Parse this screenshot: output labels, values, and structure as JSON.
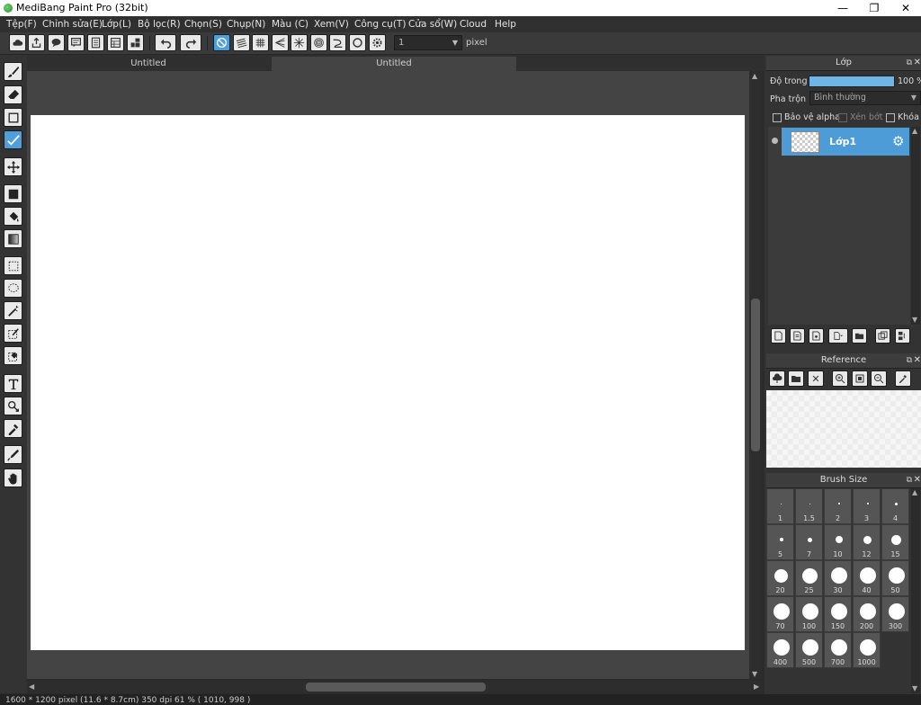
{
  "window": {
    "title": "MediBang Paint Pro (32bit)",
    "minimize": "—",
    "maximize": "❐",
    "close": "✕"
  },
  "menu": [
    "Tệp(F)",
    "Chỉnh sửa(E)",
    "Lớp(L)",
    "Bộ lọc(R)",
    "Chọn(S)",
    "Chụp(N)",
    "Màu (C)",
    "Xem(V)",
    "Công cụ(T)",
    "Cửa sổ(W)",
    "Cloud",
    "Help"
  ],
  "toolbar": {
    "brush_size_value": "1",
    "unit_label": "pixel"
  },
  "tabs": [
    "Untitled",
    "Untitled"
  ],
  "status": {
    "text": "1600 * 1200 pixel   (11.6 * 8.7cm)   350 dpi   61 %   ( 1010, 998 )"
  },
  "layer_panel": {
    "title": "Lớp",
    "opacity_label": "Độ trong",
    "opacity_value": "100 %",
    "opacity_fraction": 1.0,
    "blend_label": "Pha trộn",
    "blend_value": "Bình thường",
    "protect_alpha": "Bảo vệ alpha",
    "clipping": "Xén bớt",
    "lock": "Khóa",
    "layers": [
      {
        "name": "Lớp1"
      }
    ]
  },
  "reference_panel": {
    "title": "Reference"
  },
  "brush_size_panel": {
    "title": "Brush Size",
    "sizes": [
      "1",
      "1.5",
      "2",
      "3",
      "4",
      "5",
      "7",
      "10",
      "12",
      "15",
      "20",
      "25",
      "30",
      "40",
      "50",
      "70",
      "100",
      "150",
      "200",
      "300",
      "400",
      "500",
      "700",
      "1000"
    ]
  },
  "colors": {
    "accent": "#4e9fdc",
    "opacity_bar": "#6fb5e6",
    "canvas": "#ffffff"
  }
}
